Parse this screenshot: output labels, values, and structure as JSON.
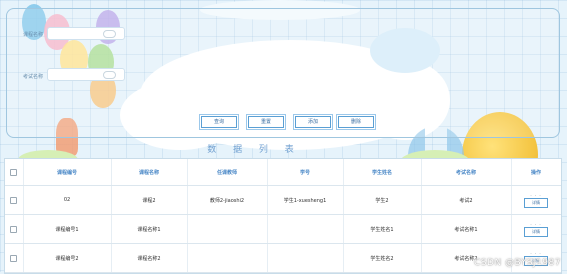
{
  "search": {
    "field1_label": "课程名称",
    "field1_value": "",
    "field2_label": "考试名称",
    "field2_value": "",
    "buttons": {
      "query": "查询",
      "reset": "重置",
      "add": "添加",
      "delete": "删除"
    }
  },
  "list_title": "数 据 列 表",
  "table": {
    "headers": [
      "课程编号",
      "课程名称",
      "任课教师",
      "学号",
      "学生姓名",
      "考试名称",
      "操作"
    ],
    "rows": [
      [
        "02",
        "课程2",
        "教师2-jiaoshi2",
        "学生1-xuesheng1",
        "学生2",
        "考试2"
      ],
      [
        "课程编号1",
        "课程名称1",
        "",
        "",
        "学生姓名1",
        "考试名称1"
      ],
      [
        "课程编号2",
        "课程名称2",
        "",
        "",
        "学生姓名2",
        "考试名称2"
      ]
    ],
    "op_dots": "· · ·",
    "op_button": "详情"
  },
  "watermark": "CSDN @BYSJ1987",
  "colors": {
    "accent": "#4a88c7",
    "border": "#5a9fd4",
    "background": "#e6f3fb"
  }
}
